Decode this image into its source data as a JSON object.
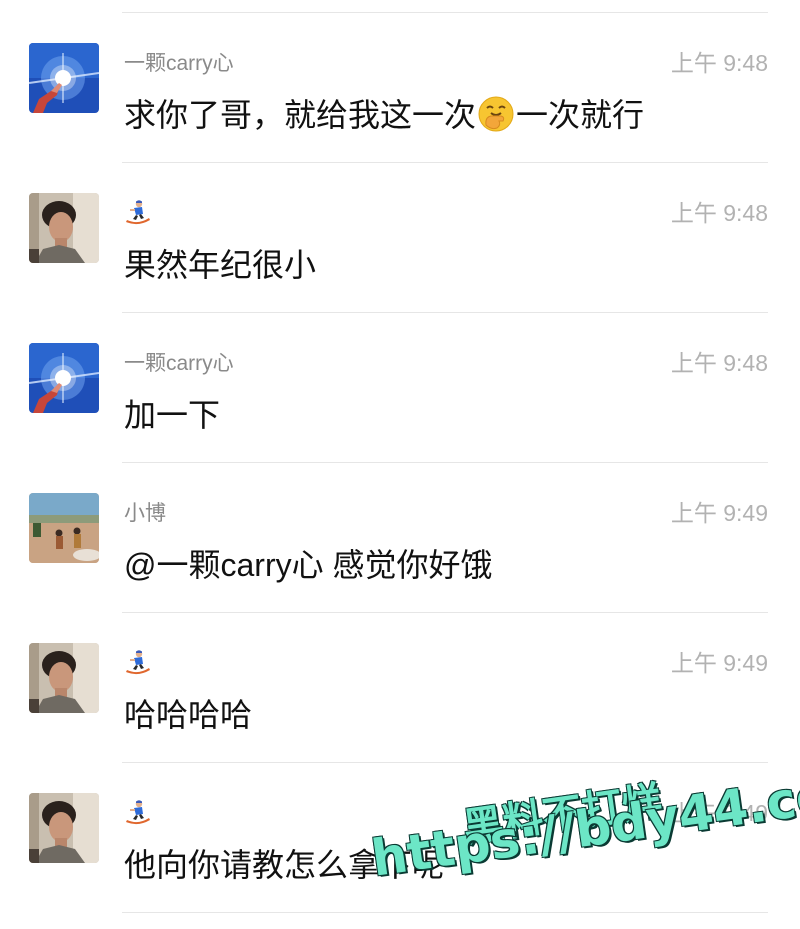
{
  "messages": [
    {
      "sender": "一颗carry心",
      "avatar": "sky-sun-avatar",
      "time": "上午 9:48",
      "text_before": "求你了哥，就给我这一次",
      "text_emoji": "hand-over-mouth-icon",
      "text_after": "一次就行"
    },
    {
      "sender": "",
      "sender_emoji": "snowboarder-icon",
      "avatar": "young-man-avatar",
      "time": "上午 9:48",
      "text": "果然年纪很小"
    },
    {
      "sender": "一颗carry心",
      "avatar": "sky-sun-avatar",
      "time": "上午 9:48",
      "text": "加一下"
    },
    {
      "sender": "小博",
      "avatar": "desert-people-avatar",
      "time": "上午 9:49",
      "text": "@一颗carry心 感觉你好饿"
    },
    {
      "sender": "",
      "sender_emoji": "snowboarder-icon",
      "avatar": "young-man-avatar",
      "time": "上午 9:49",
      "text": "哈哈哈哈"
    },
    {
      "sender": "",
      "sender_emoji": "snowboarder-icon",
      "avatar": "young-man-avatar",
      "time": "上午 9:49",
      "text": "他向你请教怎么拿下呢"
    }
  ],
  "watermark": {
    "line1": "黑料不打烊",
    "line2": "https://bdy44.co",
    "color": "#6ce6c6"
  },
  "colors": {
    "sender": "#8a8a8a",
    "time": "#b2b2b2",
    "text": "#111111",
    "divider": "#e6e6e6"
  }
}
